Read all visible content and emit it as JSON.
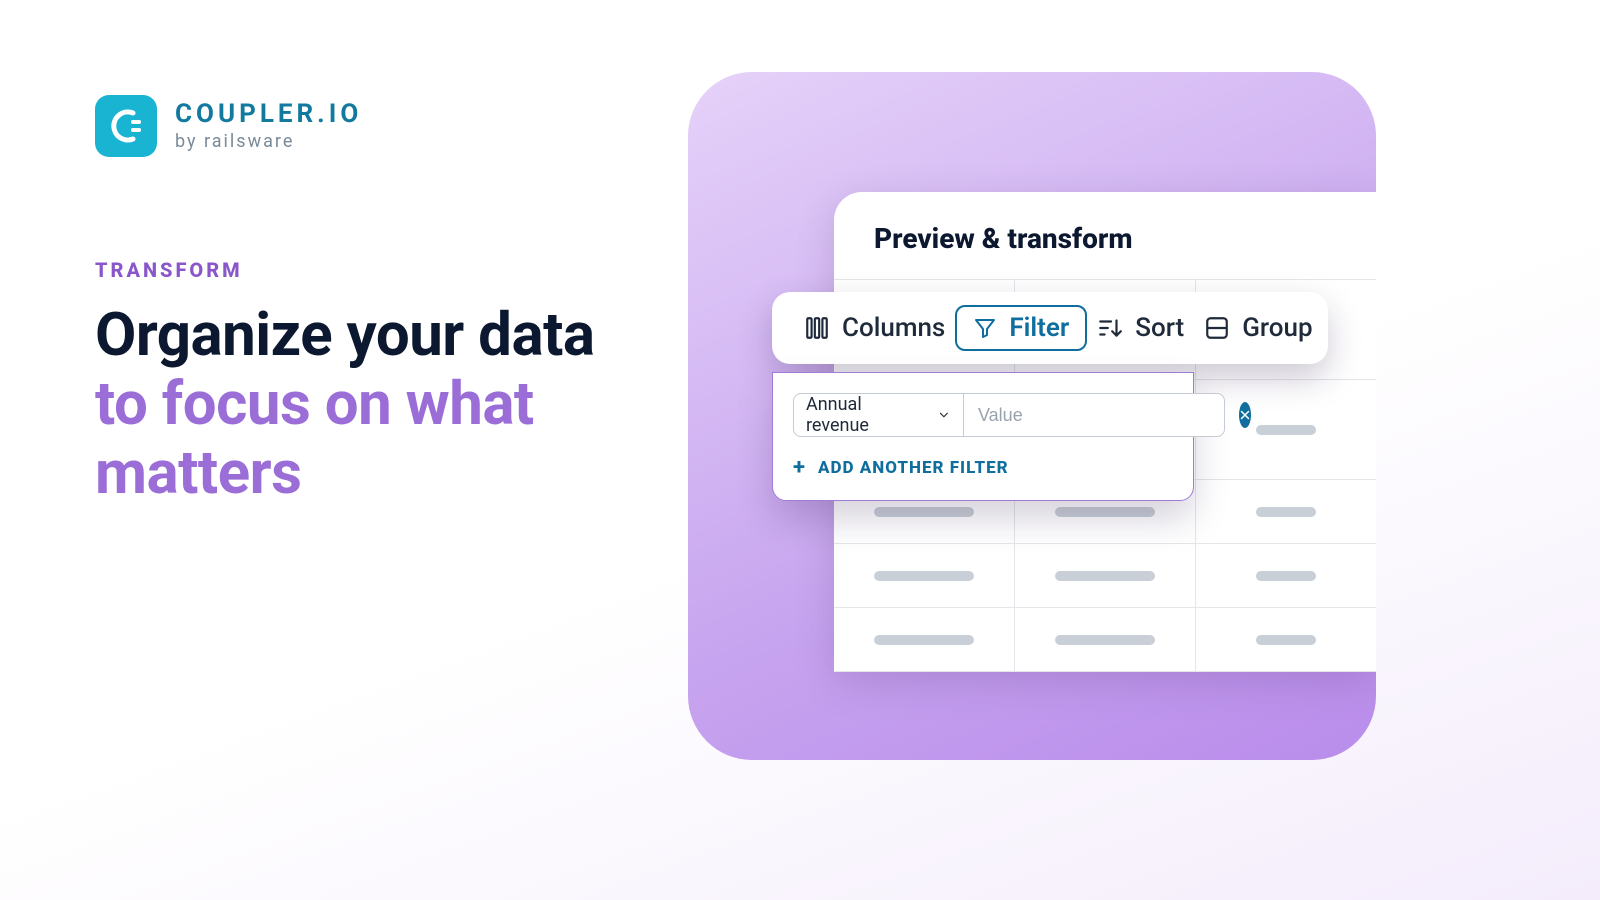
{
  "brand": {
    "title": "COUPLER.IO",
    "subtitle": "by railsware"
  },
  "eyebrow": "TRANSFORM",
  "headline": {
    "line1": "Organize your data",
    "line2": "to focus on what matters"
  },
  "card": {
    "title": "Preview & transform"
  },
  "toolbar": {
    "columns": "Columns",
    "filter": "Filter",
    "sort": "Sort",
    "group": "Group"
  },
  "filter": {
    "field": "Annual revenue",
    "value_placeholder": "Value",
    "add_label": "ADD ANOTHER FILTER"
  }
}
